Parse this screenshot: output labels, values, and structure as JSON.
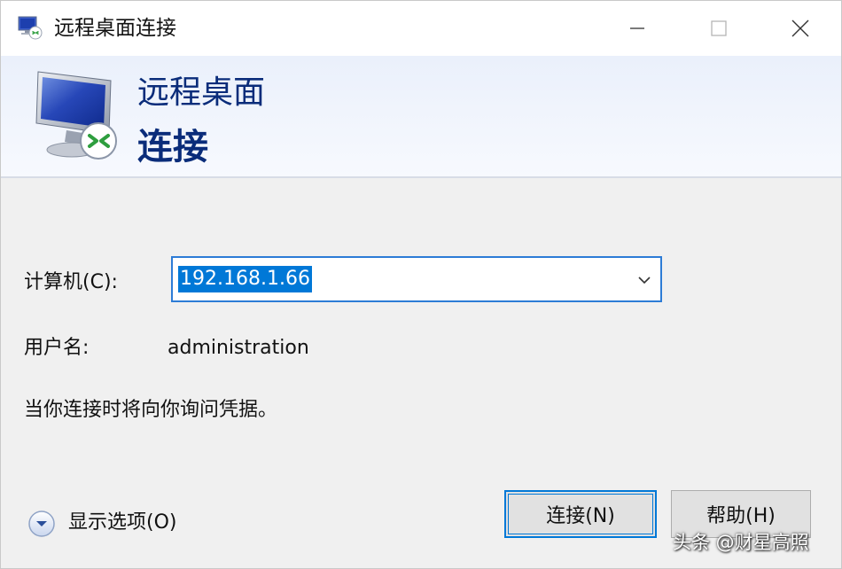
{
  "window": {
    "title": "远程桌面连接",
    "controls": {
      "minimize": "minimize-icon",
      "maximize": "maximize-icon",
      "close": "close-icon"
    }
  },
  "banner": {
    "line1": "远程桌面",
    "line2": "连接",
    "icon": "remote-desktop-monitor-icon"
  },
  "form": {
    "computer_label": "计算机(C):",
    "computer_value": "192.168.1.66",
    "username_label": "用户名:",
    "username_value": "administration",
    "credentials_note": "当你连接时将向你询问凭据。"
  },
  "options": {
    "label": "显示选项(O)",
    "icon": "chevron-down-circle-icon"
  },
  "buttons": {
    "connect": "连接(N)",
    "help": "帮助(H)"
  },
  "watermark": "头条 @财星高照",
  "colors": {
    "accent": "#0078d7",
    "banner_text": "#0a2c7a",
    "background": "#f0f0f0"
  }
}
